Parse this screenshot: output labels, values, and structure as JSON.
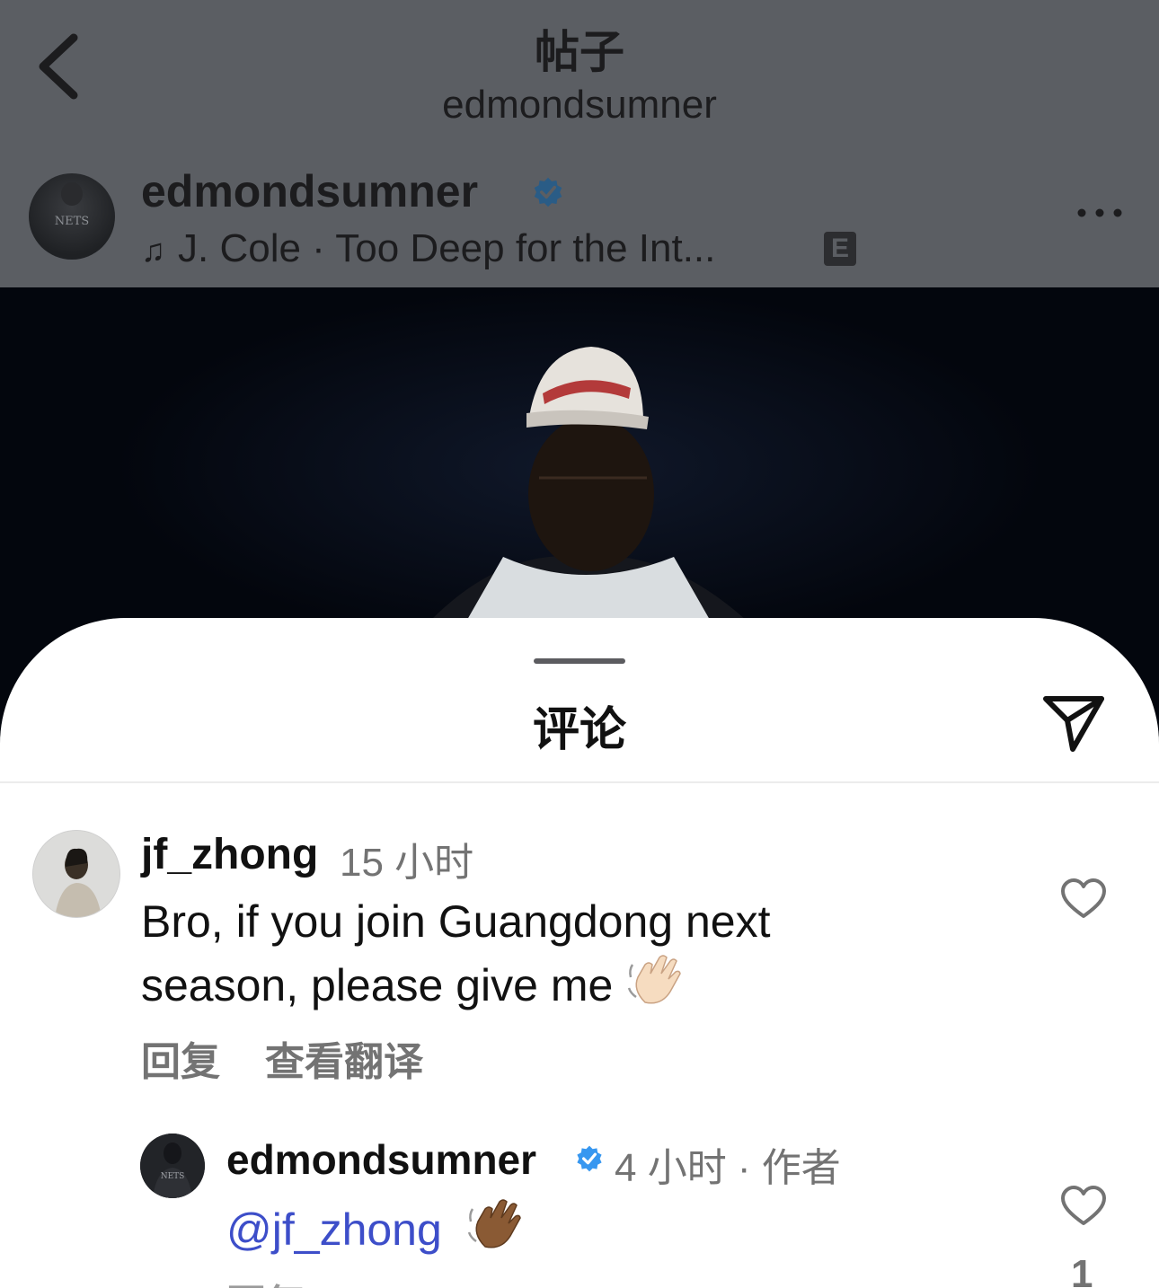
{
  "nav": {
    "title": "帖子",
    "subtitle": "edmondsumner"
  },
  "post": {
    "username": "edmondsumner",
    "verified": true,
    "avatar_text": "NETS",
    "music": "J. Cole · Too Deep for the Int...",
    "explicit_badge": "E",
    "more_icon": "ellipsis-icon"
  },
  "comments_sheet": {
    "title": "评论",
    "share_icon": "paper-plane-icon",
    "comments": [
      {
        "username": "jf_zhong",
        "time": "15 小时",
        "text": "Bro, if you join Guangdong next season, please give me",
        "emoji": "waving-hand-light",
        "reply_label": "回复",
        "translate_label": "查看翻译"
      },
      {
        "username": "edmondsumner",
        "verified": true,
        "avatar_text": "NETS",
        "meta": "4 小时 · 作者",
        "mention": "@jf_zhong",
        "emoji": "waving-hand-dark",
        "like_count": "1",
        "reply_label_partial": "回复"
      }
    ]
  },
  "colors": {
    "verified_blue": "#3797f0",
    "mention_blue": "#3d4ec9",
    "muted_gray": "#737373",
    "overlay_gray": "#5b5e63"
  }
}
